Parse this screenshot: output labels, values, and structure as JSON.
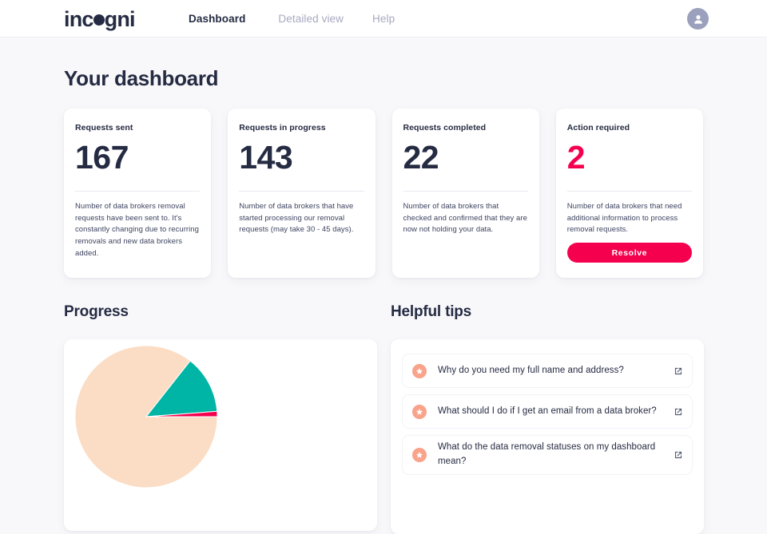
{
  "header": {
    "logo_text_before": "inc",
    "logo_dot": "o",
    "logo_text_after": "gni",
    "logo_alt": "incogni",
    "nav": [
      {
        "label": "Dashboard",
        "active": true
      },
      {
        "label": "Detailed view",
        "active": false
      },
      {
        "label": "Help",
        "active": false
      }
    ],
    "avatar_icon": "user-avatar-icon"
  },
  "main": {
    "page_title": "Your dashboard",
    "stats": [
      {
        "label": "Requests sent",
        "value": "167",
        "description": "Number of data brokers removal requests have been sent to. It's constantly changing due to recurring removals and new data brokers added.",
        "alert": false
      },
      {
        "label": "Requests in progress",
        "value": "143",
        "description": "Number of data brokers that have started processing our removal requests (may take 30 - 45 days).",
        "alert": false
      },
      {
        "label": "Requests completed",
        "value": "22",
        "description": "Number of data brokers that checked and confirmed that they are now not holding your data.",
        "alert": false
      },
      {
        "label": "Action required",
        "value": "2",
        "description": "Number of data brokers that need additional information to process removal requests.",
        "alert": true,
        "button_label": "Resolve"
      }
    ],
    "progress": {
      "title": "Progress"
    },
    "tips": {
      "title": "Helpful tips",
      "items": [
        {
          "text": "Why do you need my full name and address?",
          "icon": "star-icon",
          "link_icon": "external-link-icon"
        },
        {
          "text": "What should I do if I get an email from a data broker?",
          "icon": "star-icon",
          "link_icon": "external-link-icon"
        },
        {
          "text": "What do the data removal statuses on my dashboard mean?",
          "icon": "star-icon",
          "link_icon": "external-link-icon"
        }
      ]
    }
  },
  "chart_data": {
    "type": "pie",
    "title": "Progress",
    "categories": [
      "Requests in progress",
      "Requests completed",
      "Action required"
    ],
    "values": [
      143,
      22,
      2
    ],
    "colors": [
      "#fbddc5",
      "#00b5a5",
      "#f5004f"
    ],
    "legend": "none",
    "start_angle_deg": 0,
    "total": 167
  },
  "colors": {
    "brand_dark": "#252b42",
    "accent_pink": "#f5004f",
    "accent_teal": "#00b5a5",
    "accent_peach": "#fbddc5",
    "star_badge": "#f9a38a",
    "muted_text": "#a6a9c0",
    "page_bg": "#f8f8fb",
    "card_bg": "#ffffff"
  }
}
